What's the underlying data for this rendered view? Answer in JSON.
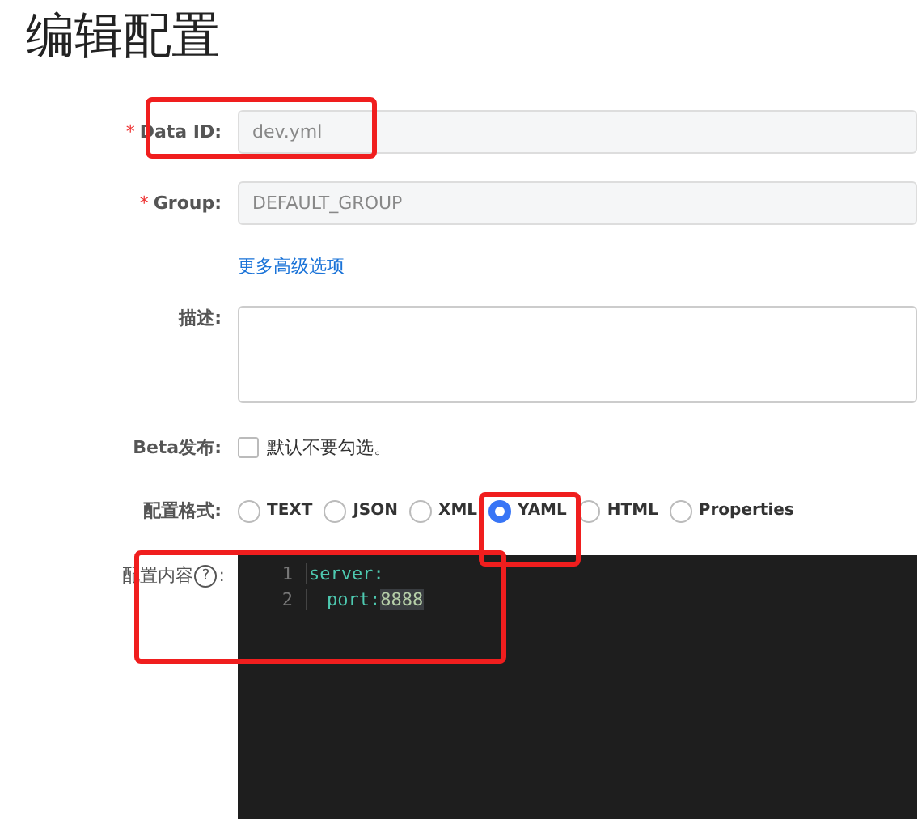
{
  "title": "编辑配置",
  "data_id": {
    "required_mark": "*",
    "label": "Data ID:",
    "value": "dev.yml"
  },
  "group": {
    "required_mark": "*",
    "label": "Group:",
    "value": "DEFAULT_GROUP"
  },
  "more_options_link": "更多高级选项",
  "description": {
    "label": "描述:"
  },
  "beta": {
    "label": "Beta发布:",
    "checked": false,
    "text": "默认不要勾选。"
  },
  "format": {
    "label": "配置格式:",
    "options": [
      {
        "label": "TEXT",
        "selected": false
      },
      {
        "label": "JSON",
        "selected": false
      },
      {
        "label": "XML",
        "selected": false
      },
      {
        "label": "YAML",
        "selected": true
      },
      {
        "label": "HTML",
        "selected": false
      },
      {
        "label": "Properties",
        "selected": false
      }
    ]
  },
  "content": {
    "label": "配置内容",
    "help_icon": "?",
    "colon": ":",
    "lines": [
      {
        "number": "1",
        "indent": false,
        "key": "server:"
      },
      {
        "number": "2",
        "indent": true,
        "key": "port:",
        "value": "8888"
      }
    ]
  }
}
